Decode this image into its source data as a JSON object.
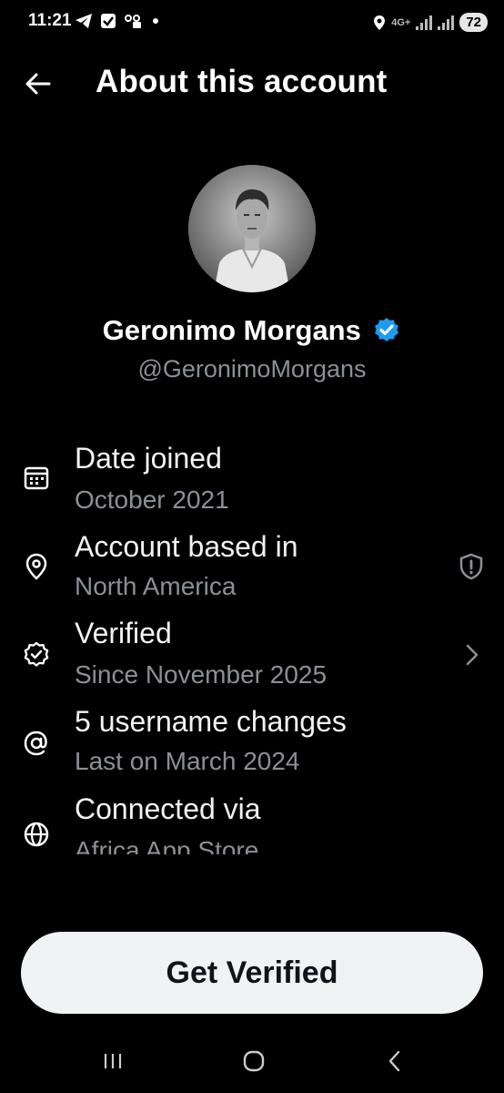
{
  "status_bar": {
    "time": "11:21",
    "network": "4G+",
    "battery": "72"
  },
  "header": {
    "title": "About this account"
  },
  "profile": {
    "display_name": "Geronimo Morgans",
    "handle": "@GeronimoMorgans",
    "verified_color": "#1d9bf0"
  },
  "rows": [
    {
      "icon": "calendar-icon",
      "title": "Date joined",
      "subtitle": "October 2021"
    },
    {
      "icon": "location-pin-icon",
      "title": "Account based in",
      "subtitle": "North America",
      "trailing": "shield-alert-icon"
    },
    {
      "icon": "verified-outline-icon",
      "title": "Verified",
      "subtitle": "Since November 2025",
      "trailing": "chevron-right-icon"
    },
    {
      "icon": "at-sign-icon",
      "title": "5 username changes",
      "subtitle": "Last on March 2024"
    },
    {
      "icon": "globe-icon",
      "title": "Connected via",
      "subtitle": "Africa App Store"
    }
  ],
  "cta": {
    "label": "Get Verified"
  },
  "colors": {
    "background": "#000000",
    "secondary_text": "#8b9096",
    "button_bg": "#eff3f4"
  }
}
